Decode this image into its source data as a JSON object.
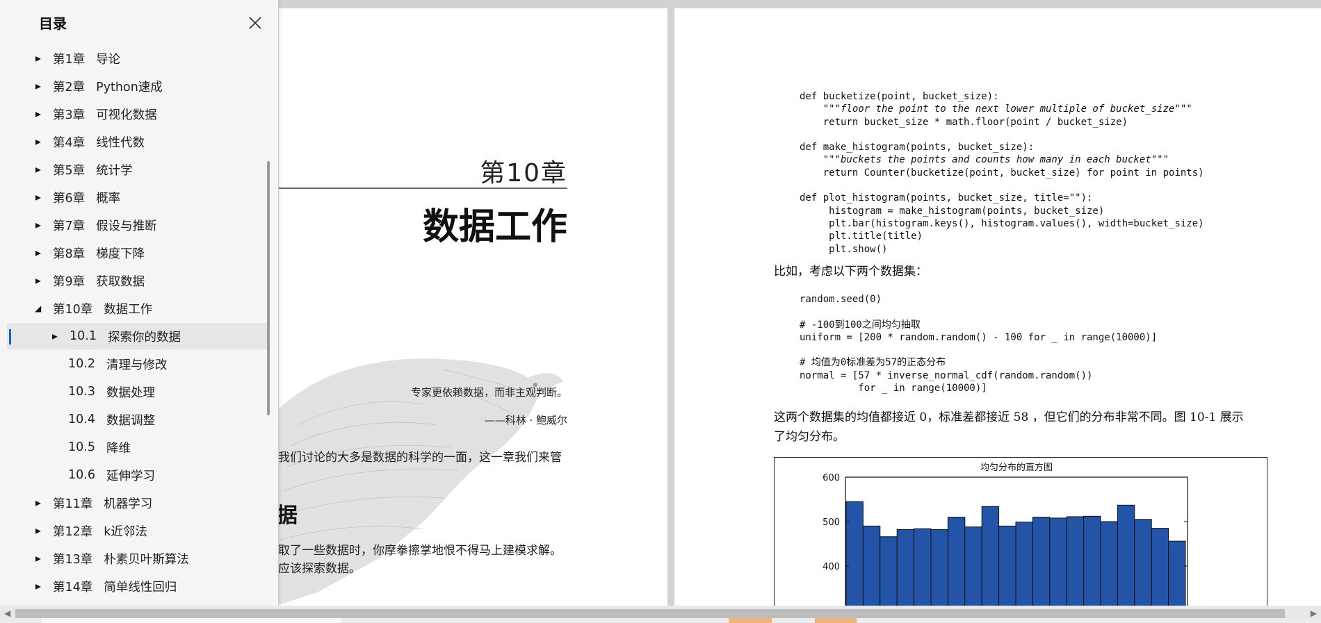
{
  "sidebar": {
    "title": "目录",
    "items": [
      {
        "num": "第1章",
        "label": "导论",
        "expanded": false
      },
      {
        "num": "第2章",
        "label": "Python速成",
        "expanded": false
      },
      {
        "num": "第3章",
        "label": "可视化数据",
        "expanded": false
      },
      {
        "num": "第4章",
        "label": "线性代数",
        "expanded": false
      },
      {
        "num": "第5章",
        "label": "统计学",
        "expanded": false
      },
      {
        "num": "第6章",
        "label": "概率",
        "expanded": false
      },
      {
        "num": "第7章",
        "label": "假设与推断",
        "expanded": false
      },
      {
        "num": "第8章",
        "label": "梯度下降",
        "expanded": false
      },
      {
        "num": "第9章",
        "label": "获取数据",
        "expanded": false
      },
      {
        "num": "第10章",
        "label": "数据工作",
        "expanded": true
      },
      {
        "num": "10.1",
        "label": "探索你的数据",
        "active": true
      },
      {
        "num": "10.2",
        "label": "清理与修改"
      },
      {
        "num": "10.3",
        "label": "数据处理"
      },
      {
        "num": "10.4",
        "label": "数据调整"
      },
      {
        "num": "10.5",
        "label": "降维"
      },
      {
        "num": "10.6",
        "label": "延伸学习"
      },
      {
        "num": "第11章",
        "label": "机器学习",
        "expanded": false
      },
      {
        "num": "第12章",
        "label": "k近邻法",
        "expanded": false
      },
      {
        "num": "第13章",
        "label": "朴素贝叶斯算法",
        "expanded": false
      },
      {
        "num": "第14章",
        "label": "简单线性回归",
        "expanded": false
      }
    ]
  },
  "left_page": {
    "chapter_number": "第10章",
    "chapter_title": "数据工作",
    "epigraph": "专家更依赖数据，而非主观判断。",
    "epigraph_author": "——科林 · 鲍威尔",
    "intro_line": "我们讨论的大多是数据的科学的一面，这一章我们来管",
    "section_heading_fragment": "据",
    "section_text_1": "取了一些数据时，你摩拳擦掌地恨不得马上建模求解。",
    "section_text_2": "应该探索数据。"
  },
  "right_page": {
    "code_1": [
      "def bucketize(point, bucket_size):",
      "    \"\"\"floor the point to the next lower multiple of bucket_size\"\"\"",
      "    return bucket_size * math.floor(point / bucket_size)",
      "",
      "def make_histogram(points, bucket_size):",
      "    \"\"\"buckets the points and counts how many in each bucket\"\"\"",
      "    return Counter(bucketize(point, bucket_size) for point in points)",
      "",
      "def plot_histogram(points, bucket_size, title=\"\"):",
      "     histogram = make_histogram(points, bucket_size)",
      "     plt.bar(histogram.keys(), histogram.values(), width=bucket_size)",
      "     plt.title(title)",
      "     plt.show()"
    ],
    "text_1": "比如，考虑以下两个数据集：",
    "code_2": [
      "random.seed(0)",
      "",
      "# -100到100之间均匀抽取",
      "uniform = [200 * random.random() - 100 for _ in range(10000)]",
      "",
      "# 均值为0标准差为57的正态分布",
      "normal = [57 * inverse_normal_cdf(random.random())",
      "          for _ in range(10000)]"
    ],
    "text_2a": "这两个数据集的均值都接近 0，标准差都接近 58 ，但它们的分布非常不同。图 10-1 展示",
    "text_2b": "了均匀分布。"
  },
  "chart_data": {
    "type": "bar",
    "title": "均匀分布的直方图",
    "ylim": [
      300,
      600
    ],
    "yticks": [
      400,
      500,
      600
    ],
    "values": [
      545,
      490,
      466,
      482,
      484,
      482,
      510,
      488,
      534,
      490,
      499,
      510,
      508,
      511,
      512,
      500,
      537,
      505,
      485,
      456
    ],
    "bar_color": "#2354a8"
  },
  "colors": {
    "accent": "#1565c0",
    "sidebar_bg": "#f5f5f5",
    "viewer_bg": "#d2d2d2"
  }
}
